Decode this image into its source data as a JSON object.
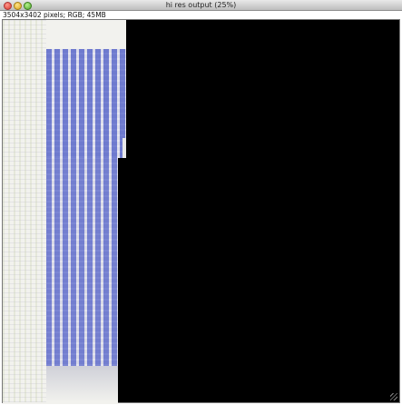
{
  "window": {
    "title": "hi res output (25%)",
    "controls": [
      "close",
      "minimize",
      "zoom"
    ]
  },
  "image_info": "3504x3402 pixels; RGB; 45MB",
  "colors": {
    "canvas_background": "#000000",
    "image_blue": "#5a68c8",
    "image_white": "#f2f2ee"
  },
  "icons": {
    "close": "close-icon",
    "minimize": "minimize-icon",
    "zoom": "zoom-icon"
  }
}
